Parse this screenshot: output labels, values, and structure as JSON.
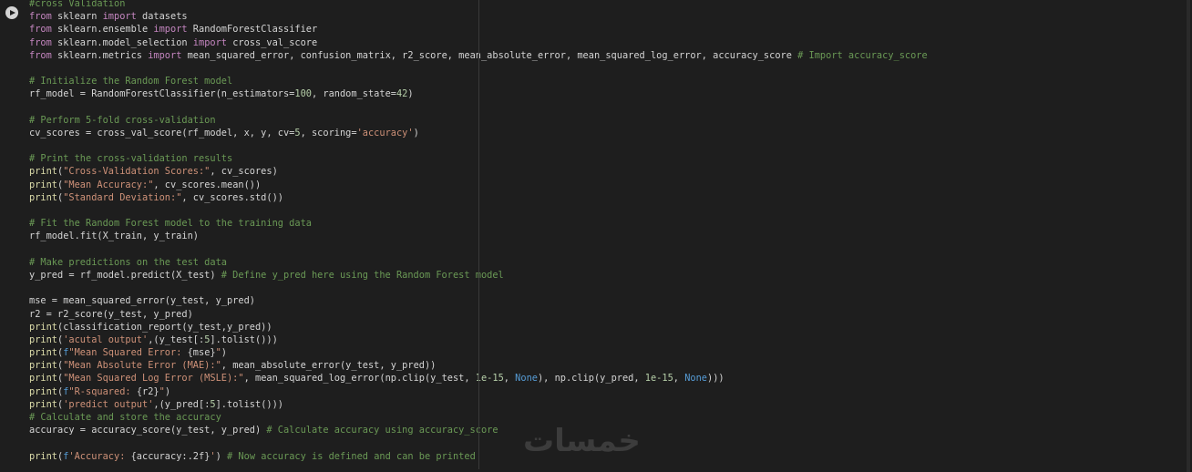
{
  "colors": {
    "background": "#1e1e1e",
    "comment": "#6a9955",
    "keyword": "#c586c0",
    "builtin": "#dcdcaa",
    "string": "#ce9178",
    "number": "#b5cea8",
    "constant": "#569cd6",
    "plain": "#d4d4d4"
  },
  "run_button": {
    "icon": "play-icon"
  },
  "watermark": {
    "text": "خمسات"
  },
  "code_lines": [
    [
      [
        "comment",
        "#cross Validation"
      ]
    ],
    [
      [
        "keyword",
        "from"
      ],
      [
        "plain",
        " sklearn "
      ],
      [
        "keyword",
        "import"
      ],
      [
        "plain",
        " datasets"
      ]
    ],
    [
      [
        "keyword",
        "from"
      ],
      [
        "plain",
        " sklearn.ensemble "
      ],
      [
        "keyword",
        "import"
      ],
      [
        "plain",
        " RandomForestClassifier"
      ]
    ],
    [
      [
        "keyword",
        "from"
      ],
      [
        "plain",
        " sklearn.model_selection "
      ],
      [
        "keyword",
        "import"
      ],
      [
        "plain",
        " cross_val_score"
      ]
    ],
    [
      [
        "keyword",
        "from"
      ],
      [
        "plain",
        " sklearn.metrics "
      ],
      [
        "keyword",
        "import"
      ],
      [
        "plain",
        " mean_squared_error, confusion_matrix, r2_score, mean_absolute_error, mean_squared_log_error, accuracy_score "
      ],
      [
        "comment",
        "# Import accuracy_score"
      ]
    ],
    [],
    [
      [
        "comment",
        "# Initialize the Random Forest model"
      ]
    ],
    [
      [
        "plain",
        "rf_model = RandomForestClassifier(n_estimators="
      ],
      [
        "number",
        "100"
      ],
      [
        "plain",
        ", random_state="
      ],
      [
        "number",
        "42"
      ],
      [
        "plain",
        ")"
      ]
    ],
    [],
    [
      [
        "comment",
        "# Perform 5-fold cross-validation"
      ]
    ],
    [
      [
        "plain",
        "cv_scores = cross_val_score(rf_model, x, y, cv="
      ],
      [
        "number",
        "5"
      ],
      [
        "plain",
        ", scoring="
      ],
      [
        "string",
        "'accuracy'"
      ],
      [
        "plain",
        ")"
      ]
    ],
    [],
    [
      [
        "comment",
        "# Print the cross-validation results"
      ]
    ],
    [
      [
        "builtin",
        "print"
      ],
      [
        "plain",
        "("
      ],
      [
        "string",
        "\"Cross-Validation Scores:\""
      ],
      [
        "plain",
        ", cv_scores)"
      ]
    ],
    [
      [
        "builtin",
        "print"
      ],
      [
        "plain",
        "("
      ],
      [
        "string",
        "\"Mean Accuracy:\""
      ],
      [
        "plain",
        ", cv_scores.mean())"
      ]
    ],
    [
      [
        "builtin",
        "print"
      ],
      [
        "plain",
        "("
      ],
      [
        "string",
        "\"Standard Deviation:\""
      ],
      [
        "plain",
        ", cv_scores.std())"
      ]
    ],
    [],
    [
      [
        "comment",
        "# Fit the Random Forest model to the training data"
      ]
    ],
    [
      [
        "plain",
        "rf_model.fit(X_train, y_train)"
      ]
    ],
    [],
    [
      [
        "comment",
        "# Make predictions on the test data"
      ]
    ],
    [
      [
        "plain",
        "y_pred = rf_model.predict(X_test) "
      ],
      [
        "comment",
        "# Define y_pred here using the Random Forest model"
      ]
    ],
    [],
    [
      [
        "plain",
        "mse = mean_squared_error(y_test, y_pred)"
      ]
    ],
    [
      [
        "plain",
        "r2 = r2_score(y_test, y_pred)"
      ]
    ],
    [
      [
        "builtin",
        "print"
      ],
      [
        "plain",
        "(classification_report(y_test,y_pred))"
      ]
    ],
    [
      [
        "builtin",
        "print"
      ],
      [
        "plain",
        "("
      ],
      [
        "string",
        "'acutal output'"
      ],
      [
        "plain",
        ",(y_test[:"
      ],
      [
        "number",
        "5"
      ],
      [
        "plain",
        "].tolist()))"
      ]
    ],
    [
      [
        "builtin",
        "print"
      ],
      [
        "plain",
        "("
      ],
      [
        "const",
        "f"
      ],
      [
        "string",
        "\"Mean Squared Error: "
      ],
      [
        "plain",
        "{mse}"
      ],
      [
        "string",
        "\""
      ],
      [
        "plain",
        ")"
      ]
    ],
    [
      [
        "builtin",
        "print"
      ],
      [
        "plain",
        "("
      ],
      [
        "string",
        "\"Mean Absolute Error (MAE):\""
      ],
      [
        "plain",
        ", mean_absolute_error(y_test, y_pred))"
      ]
    ],
    [
      [
        "builtin",
        "print"
      ],
      [
        "plain",
        "("
      ],
      [
        "string",
        "\"Mean Squared Log Error (MSLE):\""
      ],
      [
        "plain",
        ", mean_squared_log_error(np.clip(y_test, "
      ],
      [
        "number",
        "1e-15"
      ],
      [
        "plain",
        ", "
      ],
      [
        "const",
        "None"
      ],
      [
        "plain",
        "), np.clip(y_pred, "
      ],
      [
        "number",
        "1e-15"
      ],
      [
        "plain",
        ", "
      ],
      [
        "const",
        "None"
      ],
      [
        "plain",
        ")))"
      ]
    ],
    [
      [
        "builtin",
        "print"
      ],
      [
        "plain",
        "("
      ],
      [
        "const",
        "f"
      ],
      [
        "string",
        "\"R-squared: "
      ],
      [
        "plain",
        "{r2}"
      ],
      [
        "string",
        "\""
      ],
      [
        "plain",
        ")"
      ]
    ],
    [
      [
        "builtin",
        "print"
      ],
      [
        "plain",
        "("
      ],
      [
        "string",
        "'predict output'"
      ],
      [
        "plain",
        ",(y_pred[:"
      ],
      [
        "number",
        "5"
      ],
      [
        "plain",
        "].tolist()))"
      ]
    ],
    [
      [
        "comment",
        "# Calculate and store the accuracy"
      ]
    ],
    [
      [
        "plain",
        "accuracy = accuracy_score(y_test, y_pred) "
      ],
      [
        "comment",
        "# Calculate accuracy using accuracy_score"
      ]
    ],
    [],
    [
      [
        "builtin",
        "print"
      ],
      [
        "plain",
        "("
      ],
      [
        "const",
        "f"
      ],
      [
        "string",
        "'Accuracy: "
      ],
      [
        "plain",
        "{accuracy:.2f}"
      ],
      [
        "string",
        "'"
      ],
      [
        "plain",
        ") "
      ],
      [
        "comment",
        "# Now accuracy is defined and can be printed"
      ]
    ]
  ]
}
